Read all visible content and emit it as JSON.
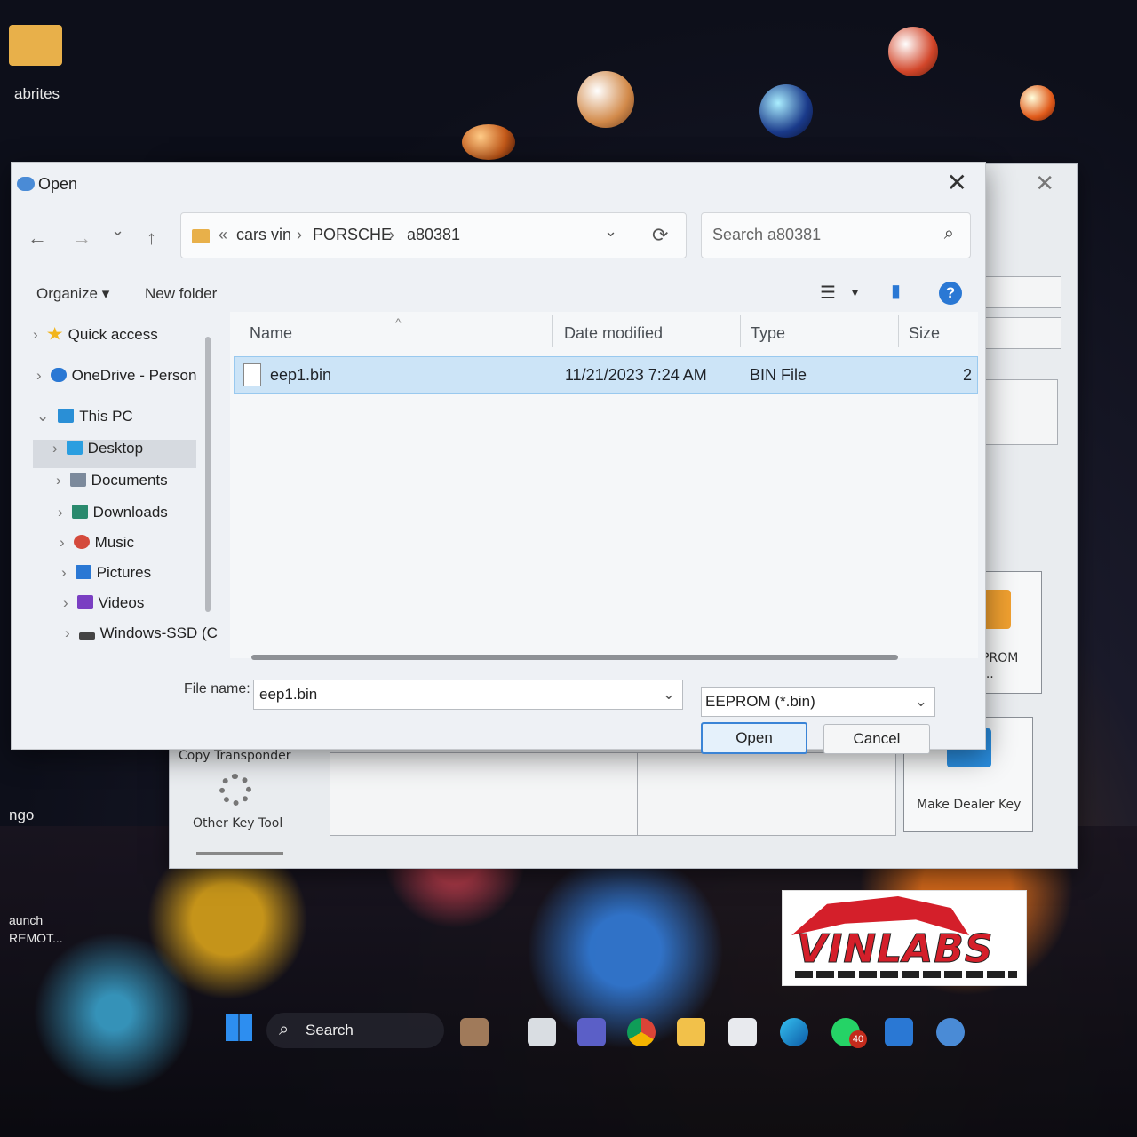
{
  "desktop": {
    "icons": [
      {
        "label": "abrites"
      },
      {
        "label": "ngo"
      },
      {
        "label": "aunch"
      },
      {
        "label": "REMOT..."
      }
    ]
  },
  "app_window": {
    "close": "✕",
    "tools": {
      "copy_transponder": "Copy Transponder",
      "other_key_tool": "Other Key Tool",
      "eeprom_dump": "d EEPROM\nump...",
      "make_dealer_key": "Make Dealer Key"
    }
  },
  "dialog": {
    "title": "Open",
    "close": "✕",
    "nav": {
      "back": "←",
      "forward": "→",
      "recent": "⌄",
      "up": "↑",
      "refresh": "⟳"
    },
    "address": {
      "prefix": "«",
      "crumbs": [
        "cars vin",
        "PORSCHE",
        "a80381"
      ],
      "separator": "›",
      "dropdown": "⌄"
    },
    "search": {
      "placeholder": "Search a80381",
      "icon": "⌕"
    },
    "commands": {
      "organize": "Organize ▾",
      "new_folder": "New folder",
      "view": "☰",
      "view_dd": "▾",
      "preview": "▮",
      "help": "?"
    },
    "sidebar": [
      {
        "label": "Quick access",
        "icon": "star-icon",
        "color": "#f2b51c"
      },
      {
        "label": "OneDrive - Person",
        "icon": "cloud-icon",
        "color": "#2a78d4"
      },
      {
        "label": "This PC",
        "icon": "computer-icon",
        "color": "#2a8fd6"
      },
      {
        "label": "Desktop",
        "icon": "desktop-icon",
        "color": "#2a9ee0"
      },
      {
        "label": "Documents",
        "icon": "document-icon",
        "color": "#7c8a9c"
      },
      {
        "label": "Downloads",
        "icon": "download-icon",
        "color": "#2a8a6e"
      },
      {
        "label": "Music",
        "icon": "music-icon",
        "color": "#d44a3c"
      },
      {
        "label": "Pictures",
        "icon": "pictures-icon",
        "color": "#2a78d4"
      },
      {
        "label": "Videos",
        "icon": "videos-icon",
        "color": "#7a3fc2"
      },
      {
        "label": "Windows-SSD (C",
        "icon": "drive-icon",
        "color": "#444444"
      }
    ],
    "columns": {
      "name": "Name",
      "date": "Date modified",
      "type": "Type",
      "size": "Size",
      "sort": "^"
    },
    "files": [
      {
        "name": "eep1.bin",
        "date": "11/21/2023 7:24 AM",
        "type": "BIN File",
        "size": "2"
      }
    ],
    "file_name_label": "File name:",
    "file_name_value": "eep1.bin",
    "file_type": "EEPROM (*.bin)",
    "open_label": "Open",
    "cancel_label": "Cancel"
  },
  "taskbar": {
    "search_label": "Search",
    "search_icon": "⌕",
    "whatsapp_badge": "40"
  },
  "watermark": {
    "text": "VINLABS",
    "color": "#d41f2a"
  }
}
